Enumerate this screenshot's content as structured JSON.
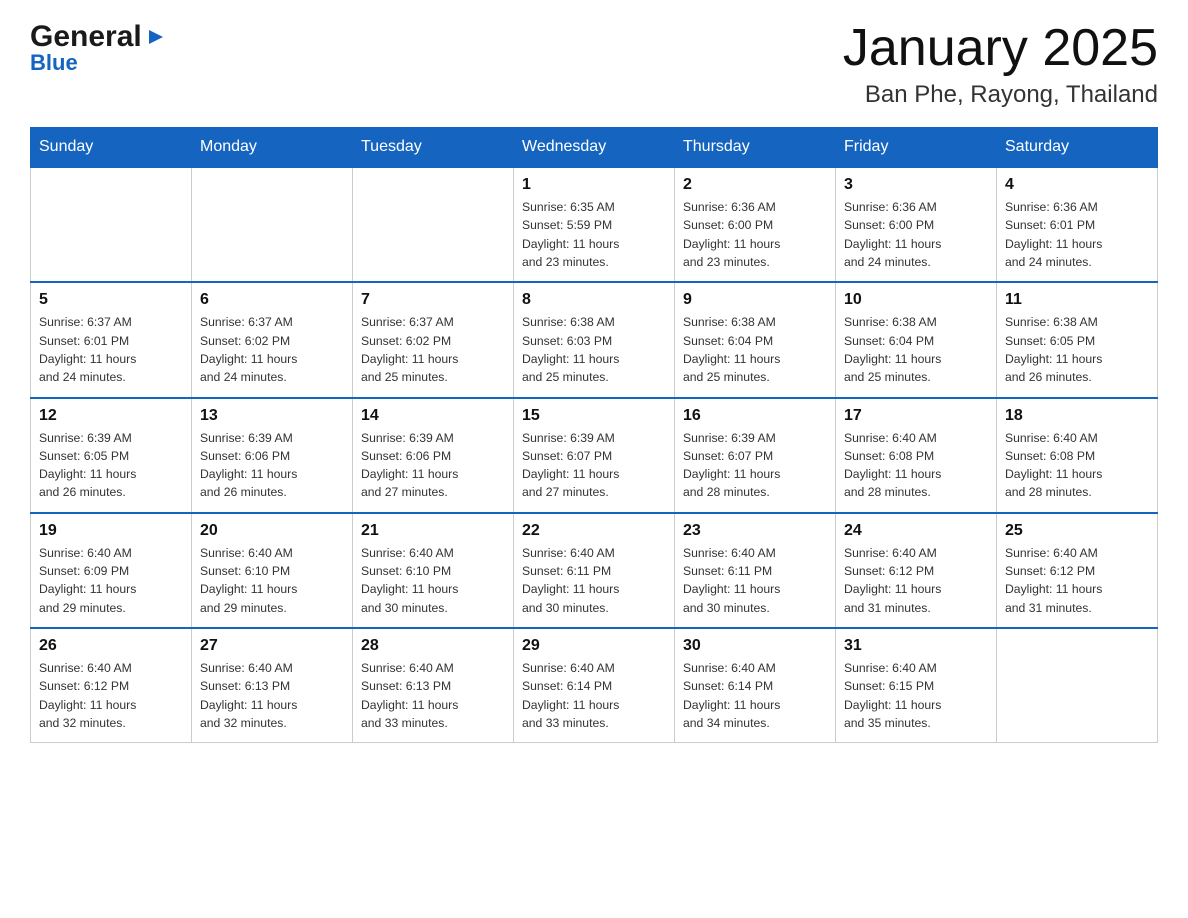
{
  "header": {
    "logo_general": "General",
    "logo_blue": "Blue",
    "month_title": "January 2025",
    "location": "Ban Phe, Rayong, Thailand"
  },
  "days_of_week": [
    "Sunday",
    "Monday",
    "Tuesday",
    "Wednesday",
    "Thursday",
    "Friday",
    "Saturday"
  ],
  "weeks": [
    [
      {
        "day": "",
        "info": ""
      },
      {
        "day": "",
        "info": ""
      },
      {
        "day": "",
        "info": ""
      },
      {
        "day": "1",
        "info": "Sunrise: 6:35 AM\nSunset: 5:59 PM\nDaylight: 11 hours\nand 23 minutes."
      },
      {
        "day": "2",
        "info": "Sunrise: 6:36 AM\nSunset: 6:00 PM\nDaylight: 11 hours\nand 23 minutes."
      },
      {
        "day": "3",
        "info": "Sunrise: 6:36 AM\nSunset: 6:00 PM\nDaylight: 11 hours\nand 24 minutes."
      },
      {
        "day": "4",
        "info": "Sunrise: 6:36 AM\nSunset: 6:01 PM\nDaylight: 11 hours\nand 24 minutes."
      }
    ],
    [
      {
        "day": "5",
        "info": "Sunrise: 6:37 AM\nSunset: 6:01 PM\nDaylight: 11 hours\nand 24 minutes."
      },
      {
        "day": "6",
        "info": "Sunrise: 6:37 AM\nSunset: 6:02 PM\nDaylight: 11 hours\nand 24 minutes."
      },
      {
        "day": "7",
        "info": "Sunrise: 6:37 AM\nSunset: 6:02 PM\nDaylight: 11 hours\nand 25 minutes."
      },
      {
        "day": "8",
        "info": "Sunrise: 6:38 AM\nSunset: 6:03 PM\nDaylight: 11 hours\nand 25 minutes."
      },
      {
        "day": "9",
        "info": "Sunrise: 6:38 AM\nSunset: 6:04 PM\nDaylight: 11 hours\nand 25 minutes."
      },
      {
        "day": "10",
        "info": "Sunrise: 6:38 AM\nSunset: 6:04 PM\nDaylight: 11 hours\nand 25 minutes."
      },
      {
        "day": "11",
        "info": "Sunrise: 6:38 AM\nSunset: 6:05 PM\nDaylight: 11 hours\nand 26 minutes."
      }
    ],
    [
      {
        "day": "12",
        "info": "Sunrise: 6:39 AM\nSunset: 6:05 PM\nDaylight: 11 hours\nand 26 minutes."
      },
      {
        "day": "13",
        "info": "Sunrise: 6:39 AM\nSunset: 6:06 PM\nDaylight: 11 hours\nand 26 minutes."
      },
      {
        "day": "14",
        "info": "Sunrise: 6:39 AM\nSunset: 6:06 PM\nDaylight: 11 hours\nand 27 minutes."
      },
      {
        "day": "15",
        "info": "Sunrise: 6:39 AM\nSunset: 6:07 PM\nDaylight: 11 hours\nand 27 minutes."
      },
      {
        "day": "16",
        "info": "Sunrise: 6:39 AM\nSunset: 6:07 PM\nDaylight: 11 hours\nand 28 minutes."
      },
      {
        "day": "17",
        "info": "Sunrise: 6:40 AM\nSunset: 6:08 PM\nDaylight: 11 hours\nand 28 minutes."
      },
      {
        "day": "18",
        "info": "Sunrise: 6:40 AM\nSunset: 6:08 PM\nDaylight: 11 hours\nand 28 minutes."
      }
    ],
    [
      {
        "day": "19",
        "info": "Sunrise: 6:40 AM\nSunset: 6:09 PM\nDaylight: 11 hours\nand 29 minutes."
      },
      {
        "day": "20",
        "info": "Sunrise: 6:40 AM\nSunset: 6:10 PM\nDaylight: 11 hours\nand 29 minutes."
      },
      {
        "day": "21",
        "info": "Sunrise: 6:40 AM\nSunset: 6:10 PM\nDaylight: 11 hours\nand 30 minutes."
      },
      {
        "day": "22",
        "info": "Sunrise: 6:40 AM\nSunset: 6:11 PM\nDaylight: 11 hours\nand 30 minutes."
      },
      {
        "day": "23",
        "info": "Sunrise: 6:40 AM\nSunset: 6:11 PM\nDaylight: 11 hours\nand 30 minutes."
      },
      {
        "day": "24",
        "info": "Sunrise: 6:40 AM\nSunset: 6:12 PM\nDaylight: 11 hours\nand 31 minutes."
      },
      {
        "day": "25",
        "info": "Sunrise: 6:40 AM\nSunset: 6:12 PM\nDaylight: 11 hours\nand 31 minutes."
      }
    ],
    [
      {
        "day": "26",
        "info": "Sunrise: 6:40 AM\nSunset: 6:12 PM\nDaylight: 11 hours\nand 32 minutes."
      },
      {
        "day": "27",
        "info": "Sunrise: 6:40 AM\nSunset: 6:13 PM\nDaylight: 11 hours\nand 32 minutes."
      },
      {
        "day": "28",
        "info": "Sunrise: 6:40 AM\nSunset: 6:13 PM\nDaylight: 11 hours\nand 33 minutes."
      },
      {
        "day": "29",
        "info": "Sunrise: 6:40 AM\nSunset: 6:14 PM\nDaylight: 11 hours\nand 33 minutes."
      },
      {
        "day": "30",
        "info": "Sunrise: 6:40 AM\nSunset: 6:14 PM\nDaylight: 11 hours\nand 34 minutes."
      },
      {
        "day": "31",
        "info": "Sunrise: 6:40 AM\nSunset: 6:15 PM\nDaylight: 11 hours\nand 35 minutes."
      },
      {
        "day": "",
        "info": ""
      }
    ]
  ]
}
